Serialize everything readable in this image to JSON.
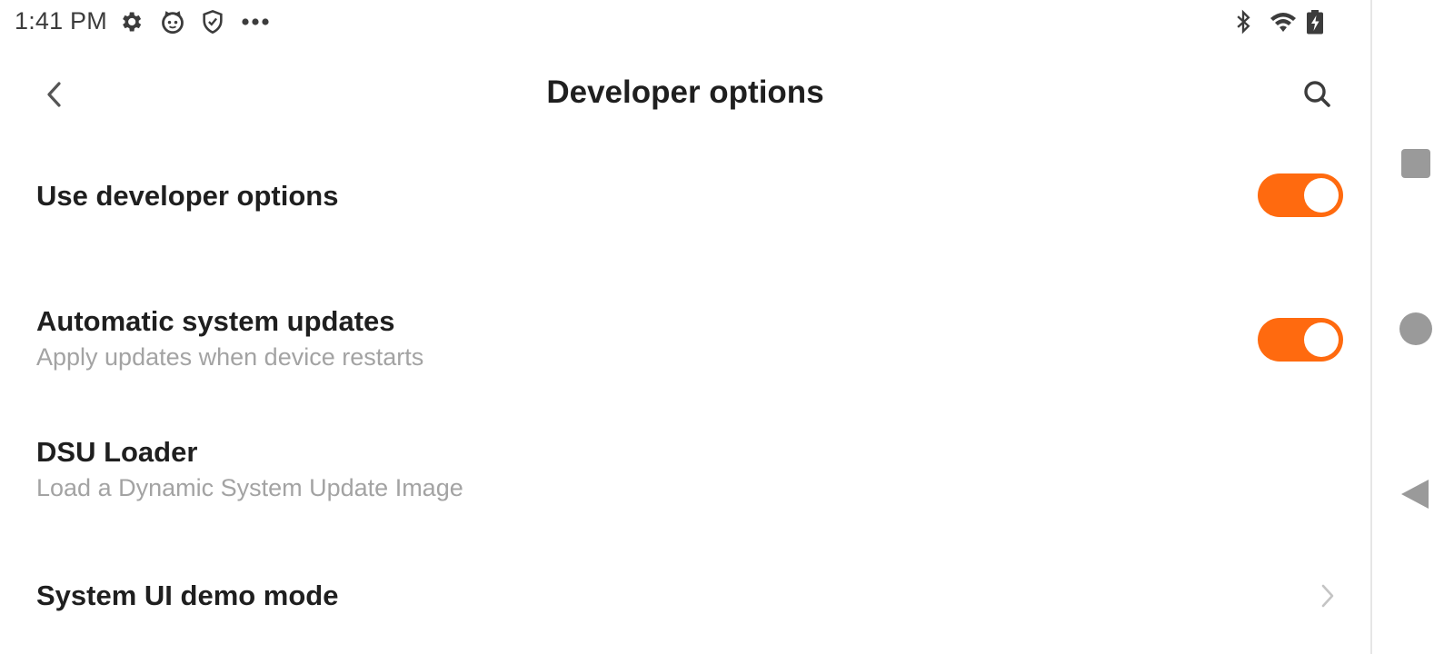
{
  "status_bar": {
    "time": "1:41 PM",
    "left_icons": [
      "gear-icon",
      "cat-face-icon",
      "shield-icon",
      "more-dots-icon"
    ],
    "right_icons": [
      "bluetooth-icon",
      "wifi-icon",
      "battery-charging-icon"
    ]
  },
  "header": {
    "title": "Developer options",
    "back_icon": "chevron-left-icon",
    "search_icon": "search-icon"
  },
  "settings": [
    {
      "title": "Use developer options",
      "subtitle": "",
      "control": "toggle",
      "enabled": true
    },
    {
      "title": "Automatic system updates",
      "subtitle": "Apply updates when device restarts",
      "control": "toggle",
      "enabled": true
    },
    {
      "title": "DSU Loader",
      "subtitle": "Load a Dynamic System Update Image",
      "control": "none"
    },
    {
      "title": "System UI demo mode",
      "subtitle": "",
      "control": "chevron"
    }
  ],
  "navigation_bar": {
    "buttons": [
      "recents-square-icon",
      "home-circle-icon",
      "back-triangle-icon"
    ]
  },
  "colors": {
    "accent": "#ff6a0f",
    "title_text": "#1f1f1f",
    "subtitle_text": "#a3a3a3",
    "status_icons": "#3c3c3c",
    "nav_icons": "#9a9a9a"
  }
}
